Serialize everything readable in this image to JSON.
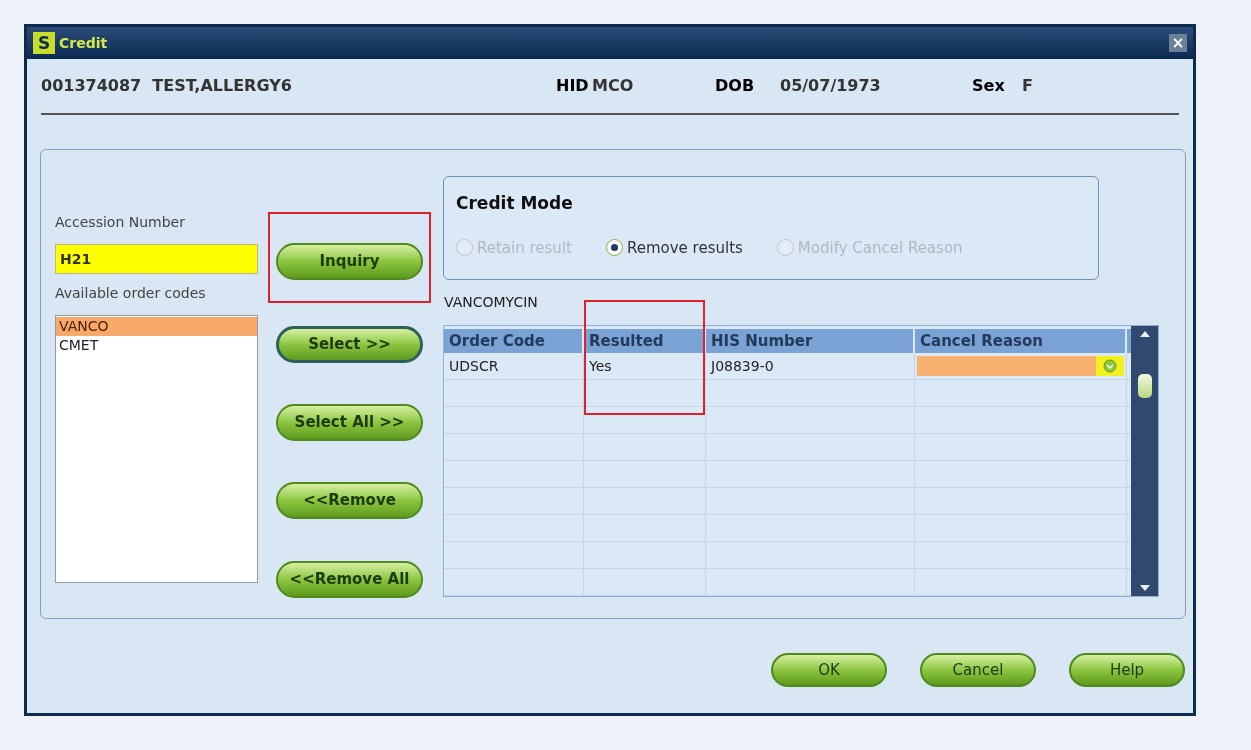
{
  "window": {
    "title": "Credit",
    "app_badge": "S",
    "close": "×"
  },
  "patient": {
    "id_name": "001374087  TEST,ALLERGY6",
    "fields": [
      {
        "label": "HID",
        "value": "MCO"
      },
      {
        "label": "DOB",
        "value": "05/07/1973"
      },
      {
        "label": "Sex",
        "value": "F"
      }
    ]
  },
  "accession": {
    "label": "Accession Number",
    "value": "H21"
  },
  "order_codes": {
    "label": "Available order codes",
    "items": [
      {
        "text": "VANCO",
        "selected": true
      },
      {
        "text": "CMET",
        "selected": false
      }
    ]
  },
  "move_buttons": [
    {
      "label": "Inquiry",
      "focused": false,
      "highlighted": true
    },
    {
      "label": "Select >>",
      "focused": true,
      "highlighted": false
    },
    {
      "label": "Select All >>",
      "focused": false,
      "highlighted": false
    },
    {
      "label": "<<Remove",
      "focused": false,
      "highlighted": false
    },
    {
      "label": "<<Remove All",
      "focused": false,
      "highlighted": false
    }
  ],
  "credit_mode": {
    "title": "Credit Mode",
    "options": [
      {
        "label": "Retain result",
        "selected": false,
        "disabled": true
      },
      {
        "label": "Remove results",
        "selected": true,
        "disabled": false
      },
      {
        "label": "Modify Cancel Reason",
        "selected": false,
        "disabled": true
      }
    ]
  },
  "test_name": "VANCOMYCIN",
  "table": {
    "columns": [
      {
        "label": "Order Code",
        "highlighted": false
      },
      {
        "label": "Resulted",
        "highlighted": true
      },
      {
        "label": "HIS Number",
        "highlighted": false
      },
      {
        "label": "Cancel Reason",
        "highlighted": false
      }
    ],
    "rows": [
      {
        "order_code": "UDSCR",
        "resulted": "Yes",
        "his_number": "J08839-0",
        "cancel_reason_active": true
      }
    ]
  },
  "buttons": [
    "OK",
    "Cancel",
    "Help"
  ]
}
